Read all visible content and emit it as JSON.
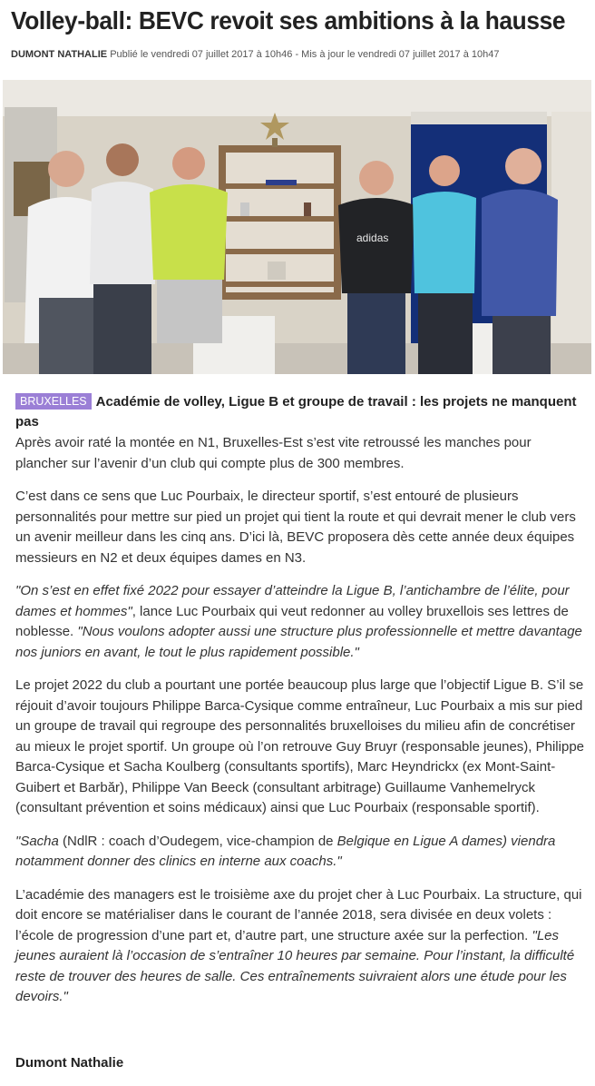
{
  "article": {
    "title": "Volley-ball: BEVC revoit ses ambitions à la hausse",
    "author": "DUMONT NATHALIE",
    "published": "Publié le vendredi 07 juillet 2017 à 10h46 - Mis à jour le vendredi 07 juillet 2017 à 10h47",
    "photo": {
      "scene": "team-photo",
      "shirt_text": "adidas",
      "colors": {
        "wall": "#d9d3c7",
        "shelf": "#8a6a4a",
        "door": "#142f78"
      }
    },
    "tag": "BRUXELLES",
    "lead": "Académie de volley, Ligue B et groupe de travail : les projets ne manquent pas",
    "paragraphs": {
      "p1": "Après avoir raté la montée en N1, Bruxelles-Est s’est vite retroussé les manches pour plancher sur l’avenir d’un club qui compte plus de 300 membres.",
      "p2": "C’est dans ce sens que Luc Pourbaix, le directeur sportif, s’est entouré de plusieurs personnalités pour mettre sur pied un projet qui tient la route et qui devrait mener le club vers un avenir meilleur dans les cinq ans. D’ici là, BEVC proposera dès cette année deux équipes messieurs en N2 et deux équipes dames en N3.",
      "p3_quote1": "\"On s’est en effet fixé 2022 pour essayer d’atteindre la Ligue B, l’antichambre de l’élite, pour dames et hommes\"",
      "p3_text": ", lance Luc Pourbaix qui veut redonner au volley bruxellois ses lettres de noblesse. ",
      "p3_quote2": "\"Nous voulons adopter aussi une structure plus professionnelle et mettre davantage nos juniors en avant, le tout le plus rapidement possible.\"",
      "p4": "Le projet 2022 du club a pourtant une portée beaucoup plus large que l’objectif Ligue B. S’il se réjouit d’avoir toujours Philippe Barca-Cysique comme entraîneur, Luc Pourbaix a mis sur pied un groupe de travail qui regroupe des personnalités bruxelloises du milieu afin de concrétiser au mieux le projet sportif. Un groupe où l’on retrouve Guy Bruyr (responsable jeunes), Philippe Barca-Cysique et Sacha Koulberg (consultants sportifs), Marc Heyndrickx (ex Mont-Saint-Guibert et Barbăr), Philippe Van Beeck (consultant arbitrage) Guillaume Vanhemelryck (consultant prévention et soins médicaux) ainsi que Luc Pourbaix (responsable sportif).",
      "p5_a": "\"Sacha",
      "p5_b": " (NdlR : coach d’Oudegem, vice-champion de ",
      "p5_c": "Belgique en Ligue A dames) viendra notamment donner des clinics en interne aux coachs.\"",
      "p6_text": "L’académie des managers est le troisième axe du projet cher à Luc Pourbaix. La structure, qui doit encore se matérialiser dans le courant de l’année 2018, sera divisée en deux volets : l’école de progression d’une part et, d’autre part, une structure axée sur la perfection. ",
      "p6_quote": "\"Les jeunes auraient là l’occasion de s’entraîner 10 heures par semaine. Pour l’instant, la difficulté reste de trouver des heures de salle. Ces entraînements suivraient alors une étude pour les devoirs.\""
    },
    "signature": "Dumont Nathalie"
  }
}
